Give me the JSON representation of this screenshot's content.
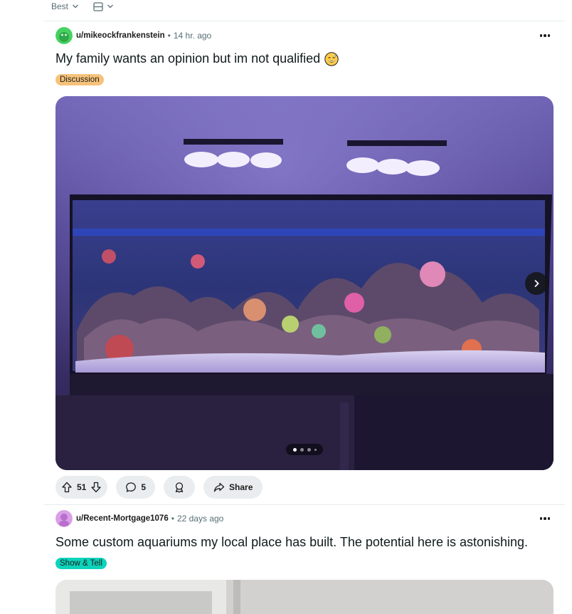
{
  "sort": {
    "label": "Best",
    "view_icon": "card-view-icon"
  },
  "posts": [
    {
      "username": "u/mikeockfrankenstein",
      "time": "14 hr. ago",
      "title": "My family wants an opinion but im not qualified",
      "title_emoji": "😅",
      "flair": "Discussion",
      "flair_color": "#f6c27a",
      "upvotes": "51",
      "comments": "5",
      "share_label": "Share",
      "gallery_pages": 4,
      "gallery_current": 1
    },
    {
      "username": "u/Recent-Mortgage1076",
      "time": "22 days ago",
      "title": "Some custom aquariums my local place has built. The potential here is astonishing.",
      "flair": "Show & Tell",
      "flair_color": "#0dd3bb"
    }
  ]
}
